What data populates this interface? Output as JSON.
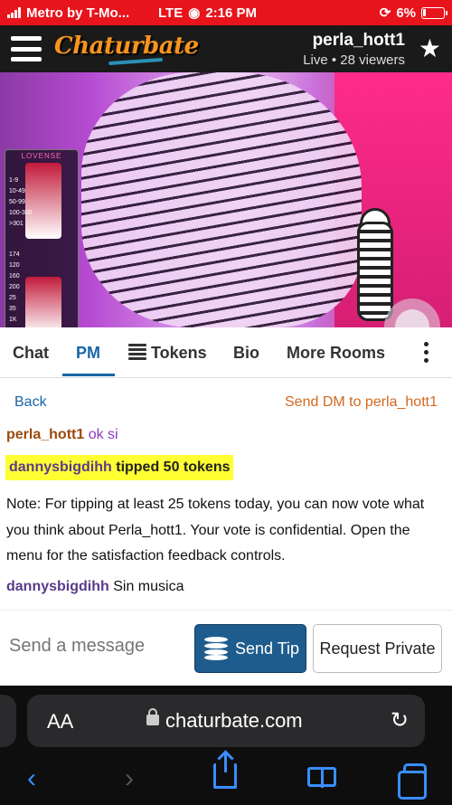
{
  "status_bar": {
    "carrier": "Metro by T-Mo...",
    "network": "LTE",
    "time": "2:16 PM",
    "battery": "6%"
  },
  "header": {
    "logo": "Chaturbate",
    "room_name": "perla_hott1",
    "room_status": "Live • 28 viewers"
  },
  "video": {
    "lovense_title": "LOVENSE",
    "lovense_levels": [
      "1-9",
      "10-49",
      "50-99",
      "100-300",
      ">301",
      "174",
      "120",
      "160",
      "200",
      "25",
      "35",
      "1K",
      "5555"
    ]
  },
  "tabs": [
    {
      "label": "Chat"
    },
    {
      "label": "PM",
      "active": true
    },
    {
      "label": "Tokens"
    },
    {
      "label": "Bio"
    },
    {
      "label": "More Rooms"
    }
  ],
  "pm_bar": {
    "back": "Back",
    "send_dm": "Send DM to perla_hott1"
  },
  "chat": {
    "msg1_user": "perla_hott1",
    "msg1_text": "ok si",
    "tip_user": "dannysbigdihh",
    "tip_text": "tipped 50 tokens",
    "note": "Note: For tipping at least 25 tokens today, you can now vote what you think about Perla_hott1. Your vote is confidential. Open the menu for the satisfaction feedback controls.",
    "msg2_user": "dannysbigdihh",
    "msg2_text": "Sin musica"
  },
  "composer": {
    "placeholder": "Send a message",
    "send_tip": "Send Tip",
    "request_private": "Request Private"
  },
  "browser": {
    "aa": "AA",
    "url": "chaturbate.com"
  },
  "colors": {
    "status_bar": "#e8141c",
    "accent": "#1a66a8",
    "tip_highlight": "#ffff33",
    "send_tip_bg": "#1e5c8e"
  }
}
